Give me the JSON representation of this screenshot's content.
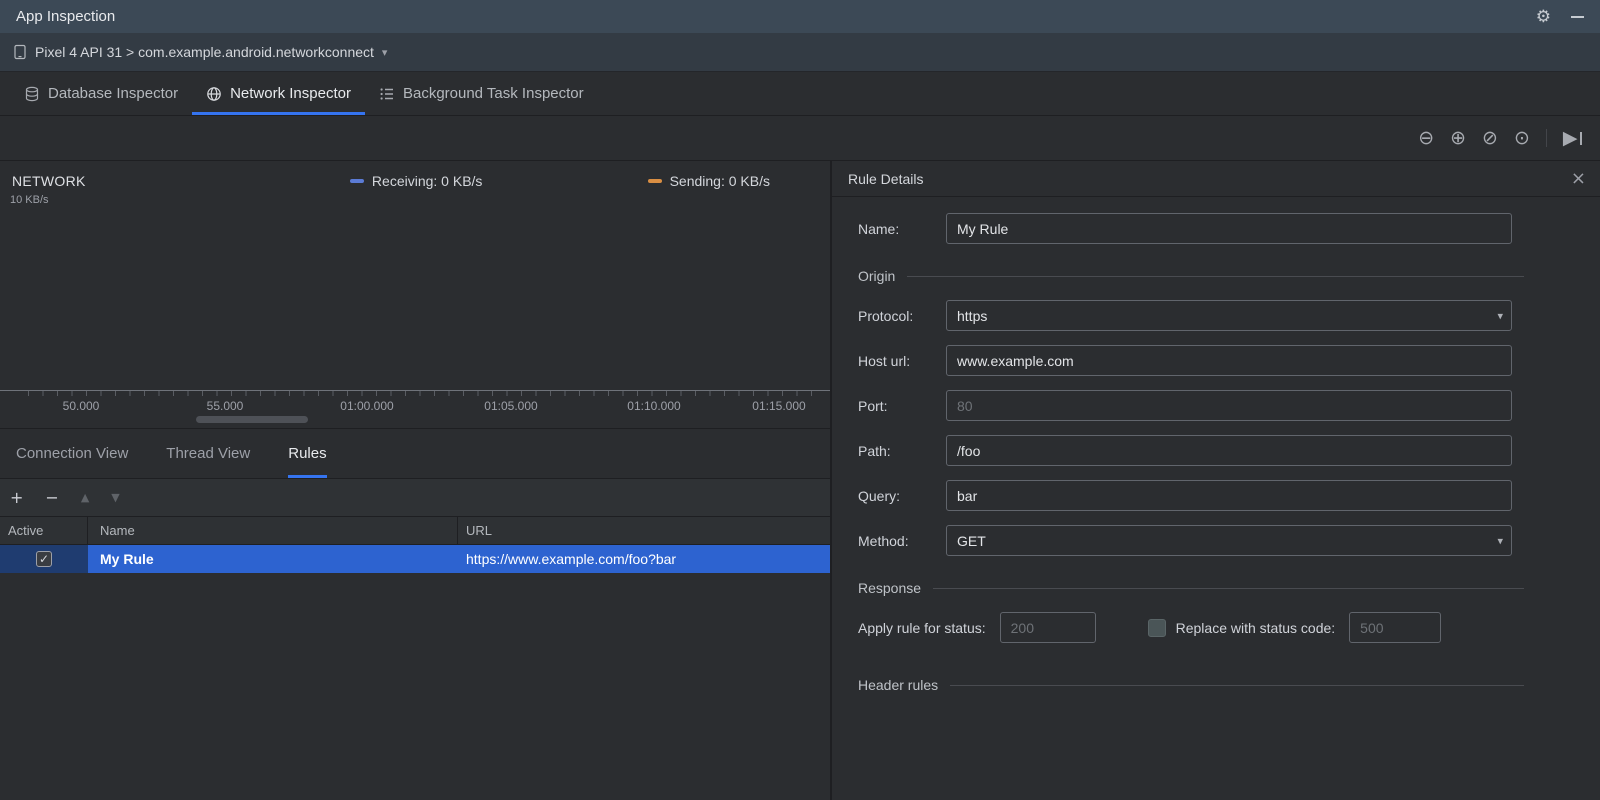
{
  "icons": {
    "gear": "⚙",
    "chevron_down": "▾",
    "dropdown_arrow": "▾",
    "close": "×",
    "check": "✓",
    "plus": "+",
    "minus": "−",
    "arrow_up": "▲",
    "arrow_down": "▼",
    "zoom_out": "⊖",
    "zoom_in": "⊕",
    "reset_zoom": "⊘",
    "zoom_selection": "⊙",
    "play": "▶"
  },
  "window": {
    "title": "App Inspection"
  },
  "process_bar": {
    "selection": "Pixel 4 API 31 > com.example.android.networkconnect"
  },
  "inspector_tabs": [
    {
      "label": "Database Inspector"
    },
    {
      "label": "Network Inspector"
    },
    {
      "label": "Background Task Inspector"
    }
  ],
  "chart": {
    "title": "NETWORK",
    "y_axis_label": "10 KB/s",
    "legend": [
      {
        "label": "Receiving: 0 KB/s",
        "color": "#5B7BD5"
      },
      {
        "label": "Sending: 0 KB/s",
        "color": "#D98E43"
      }
    ],
    "x_ticks": [
      "50.000",
      "55.000",
      "01:00.000",
      "01:05.000",
      "01:10.000",
      "01:15.000"
    ]
  },
  "view_tabs": [
    {
      "label": "Connection View"
    },
    {
      "label": "Thread View"
    },
    {
      "label": "Rules"
    }
  ],
  "rules_table": {
    "columns": [
      "Active",
      "Name",
      "URL"
    ],
    "rows": [
      {
        "active": true,
        "name": "My Rule",
        "url": "https://www.example.com/foo?bar"
      }
    ]
  },
  "rule_details": {
    "title": "Rule Details",
    "name": {
      "label": "Name:",
      "value": "My Rule"
    },
    "origin": {
      "section": "Origin",
      "protocol": {
        "label": "Protocol:",
        "value": "https"
      },
      "host": {
        "label": "Host url:",
        "value": "www.example.com"
      },
      "port": {
        "label": "Port:",
        "placeholder": "80"
      },
      "path": {
        "label": "Path:",
        "value": "/foo"
      },
      "query": {
        "label": "Query:",
        "value": "bar"
      },
      "method": {
        "label": "Method:",
        "value": "GET"
      }
    },
    "response": {
      "section": "Response",
      "apply_status": {
        "label": "Apply rule for status:",
        "placeholder": "200"
      },
      "replace_status": {
        "label": "Replace with status code:",
        "placeholder": "500"
      }
    },
    "header_rules": {
      "section": "Header rules"
    }
  }
}
